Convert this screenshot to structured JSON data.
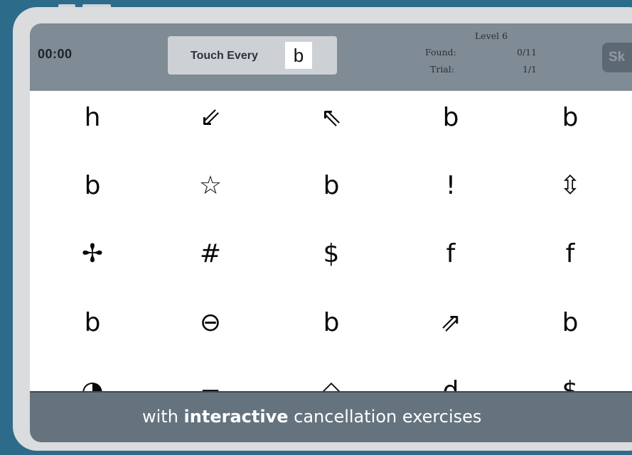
{
  "header": {
    "timer": "00:00",
    "target_label": "Touch Every",
    "target_symbol": "b",
    "level": "Level 6",
    "found_label": "Found:",
    "found_value": "0/11",
    "trial_label": "Trial:",
    "trial_value": "1/1",
    "skip_label": "Sk"
  },
  "grid": {
    "rows": [
      [
        "h",
        "⇙",
        "⇖",
        "b",
        "b"
      ],
      [
        "b",
        "☆",
        "b",
        "!",
        "⇳"
      ],
      [
        "✢",
        "#",
        "$",
        "f",
        "f"
      ],
      [
        "b",
        "⊖",
        "b",
        "⇗",
        "b"
      ],
      [
        "◑",
        "−",
        "◇",
        "d",
        "$"
      ]
    ]
  },
  "banner": {
    "prefix": "with ",
    "emphasis": "interactive",
    "suffix": " cancellation exercises"
  },
  "colors": {
    "background": "#2d6b8a",
    "header": "#7f8b95",
    "banner": "#65737e"
  }
}
